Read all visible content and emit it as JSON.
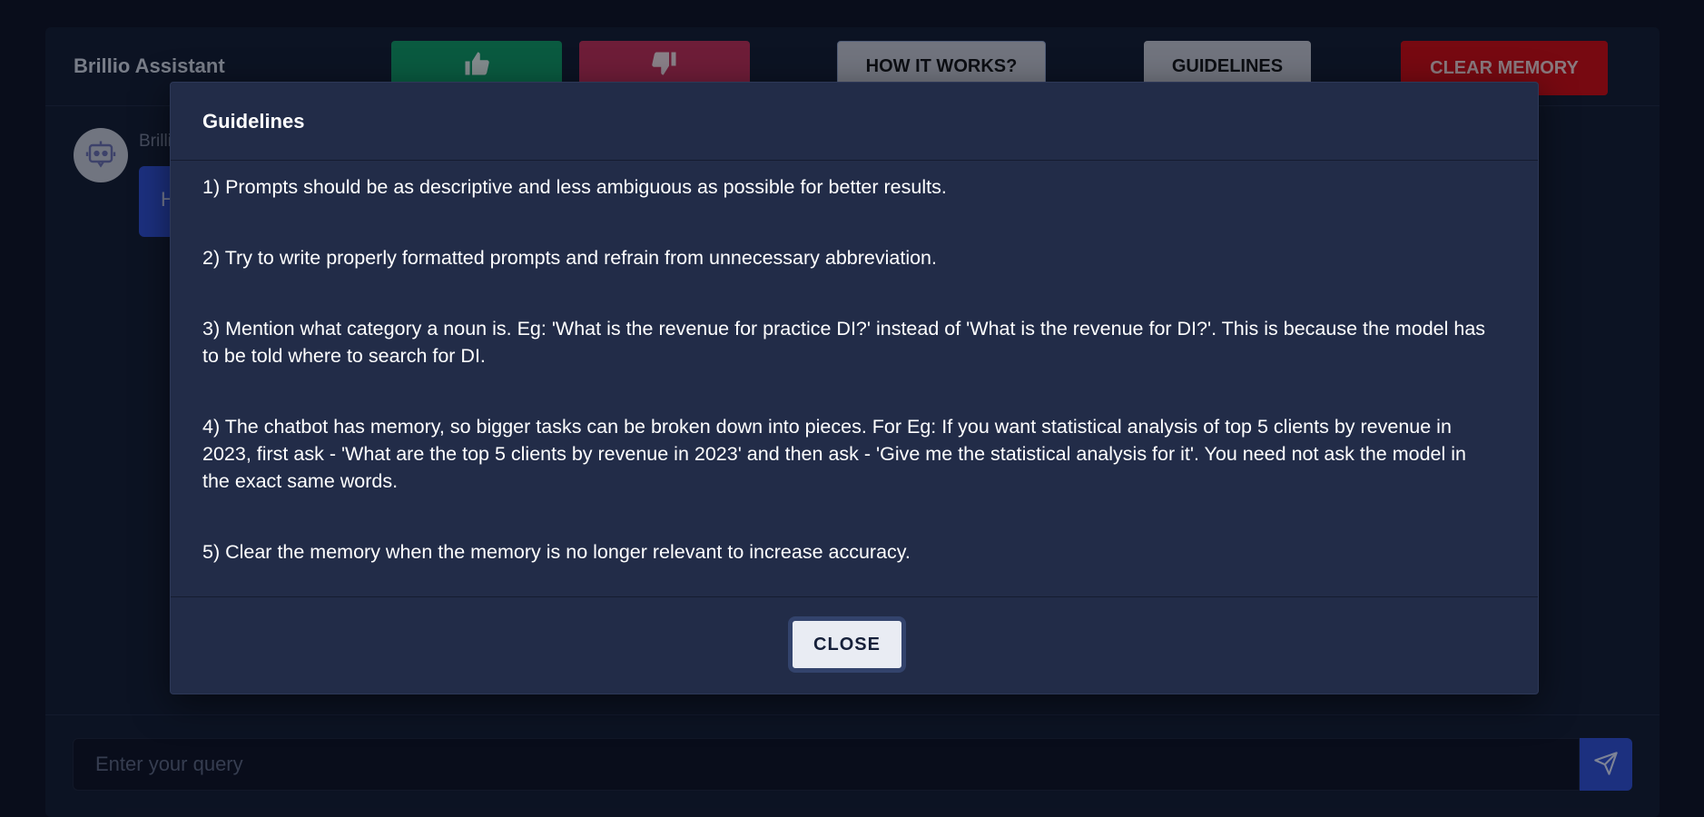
{
  "header": {
    "brand": "Brillio Assistant",
    "thumbs_up_icon": "thumbs-up-icon",
    "thumbs_down_icon": "thumbs-down-icon",
    "how_it_works_label": "HOW IT WORKS?",
    "guidelines_label": "GUIDELINES",
    "clear_memory_label": "CLEAR MEMORY"
  },
  "chat": {
    "bot_name": "Brillio Assistant",
    "bot_message": "H"
  },
  "footer": {
    "query_placeholder": "Enter your query",
    "send_icon": "send-icon"
  },
  "modal": {
    "title": "Guidelines",
    "items": [
      "1) Prompts should be as descriptive and less ambiguous as possible for better results.",
      "2) Try to write properly formatted prompts and refrain from unnecessary abbreviation.",
      "3) Mention what category a noun is. Eg: 'What is the revenue for practice DI?' instead of 'What is the revenue for DI?'. This is because the model has to be told where to search for DI.",
      "4) The chatbot has memory, so bigger tasks can be broken down into pieces. For Eg: If you want statistical analysis of top 5 clients by revenue in 2023, first ask - 'What are the top 5 clients by revenue in 2023' and then ask - 'Give me the statistical analysis for it'. You need not ask the model in the exact same words.",
      "5) Clear the memory when the memory is no longer relevant to increase accuracy."
    ],
    "close_label": "CLOSE"
  },
  "colors": {
    "thumbs_up": "#0e9b63",
    "thumbs_down": "#c42d55",
    "clear_memory": "#d4090d",
    "accent": "#2f4fd6",
    "modal_bg": "#222c48"
  }
}
